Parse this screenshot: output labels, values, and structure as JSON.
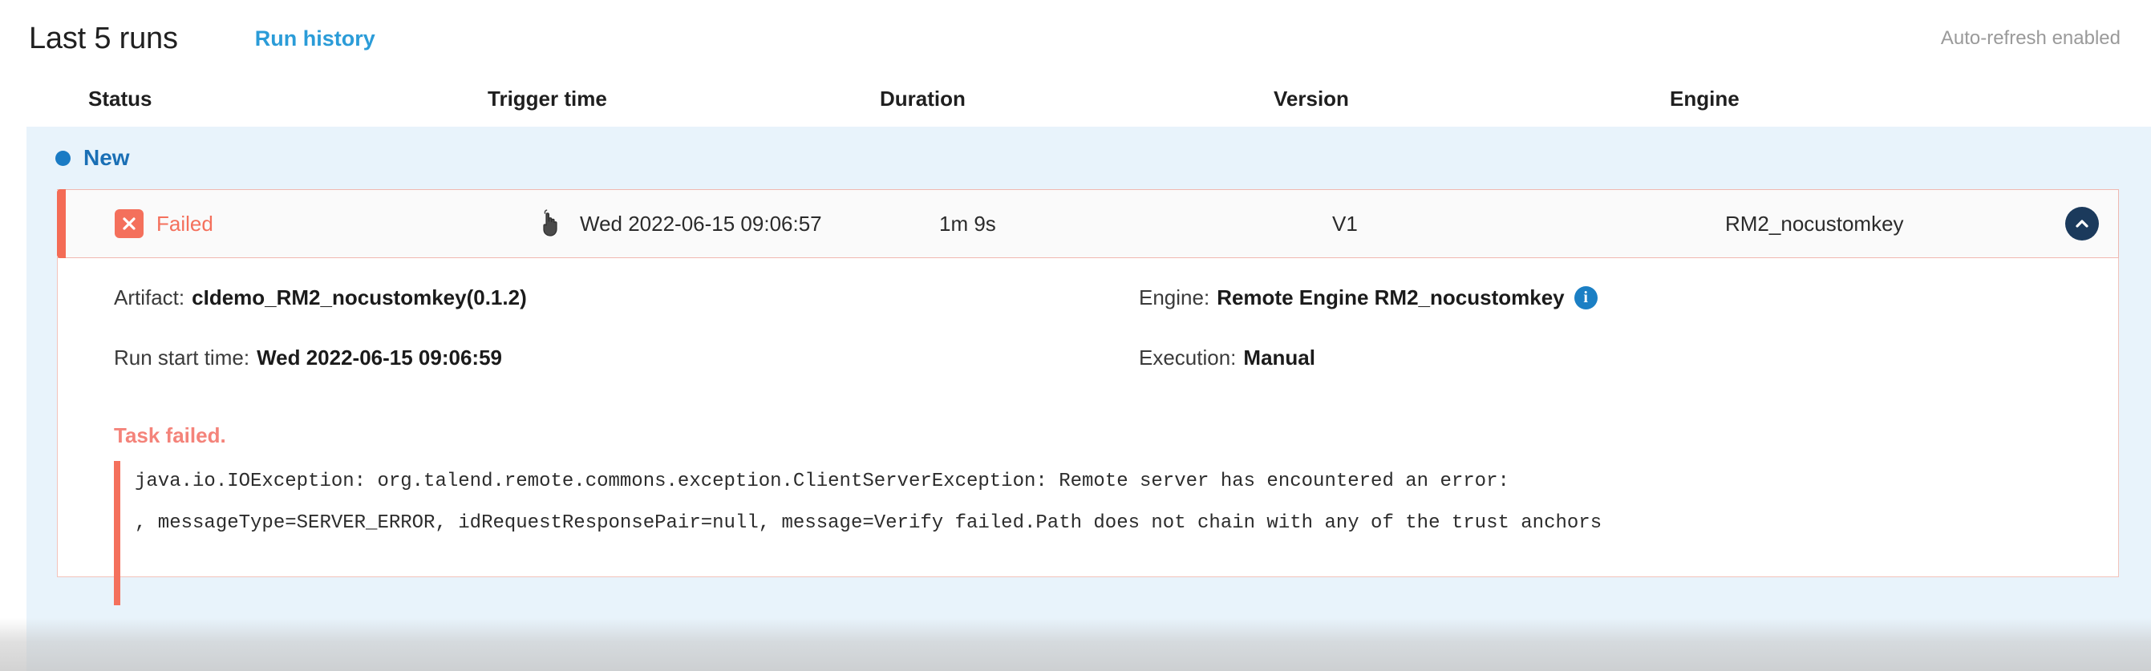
{
  "header": {
    "title": "Last 5 runs",
    "run_history_link": "Run history",
    "auto_refresh": "Auto-refresh enabled",
    "link_color": "#2b9cd8"
  },
  "table": {
    "columns": [
      "Status",
      "Trigger time",
      "Duration",
      "Version",
      "Engine"
    ]
  },
  "group": {
    "label": "New",
    "dot_color": "#1a7bc4",
    "band_color": "#e8f3fb"
  },
  "run": {
    "status": "Failed",
    "status_icon": "failed-x-icon",
    "status_color": "#f4705c",
    "trigger_time": "Wed 2022-06-15 09:06:57",
    "trigger_icon": "pointer-hand-cursor-icon",
    "duration": "1m 9s",
    "version": "V1",
    "engine": "RM2_nocustomkey",
    "collapse_icon": "chevron-up-icon",
    "collapse_icon_color": "#1b3a5c"
  },
  "details": {
    "artifact_label": "Artifact:",
    "artifact_value": "cIdemo_RM2_nocustomkey(0.1.2)",
    "engine_label": "Engine:",
    "engine_value": "Remote Engine RM2_nocustomkey",
    "engine_info_icon": "info-icon",
    "run_start_label": "Run start time:",
    "run_start_value": "Wed 2022-06-15 09:06:59",
    "execution_label": "Execution:",
    "execution_value": "Manual"
  },
  "error": {
    "heading": "Task failed.",
    "heading_color": "#f4837a",
    "accent_color": "#f4705c",
    "trace_lines": [
      "java.io.IOException: org.talend.remote.commons.exception.ClientServerException: Remote server has encountered an error:",
      ", messageType=SERVER_ERROR, idRequestResponsePair=null, message=Verify failed.Path does not chain with any of the trust anchors"
    ]
  }
}
